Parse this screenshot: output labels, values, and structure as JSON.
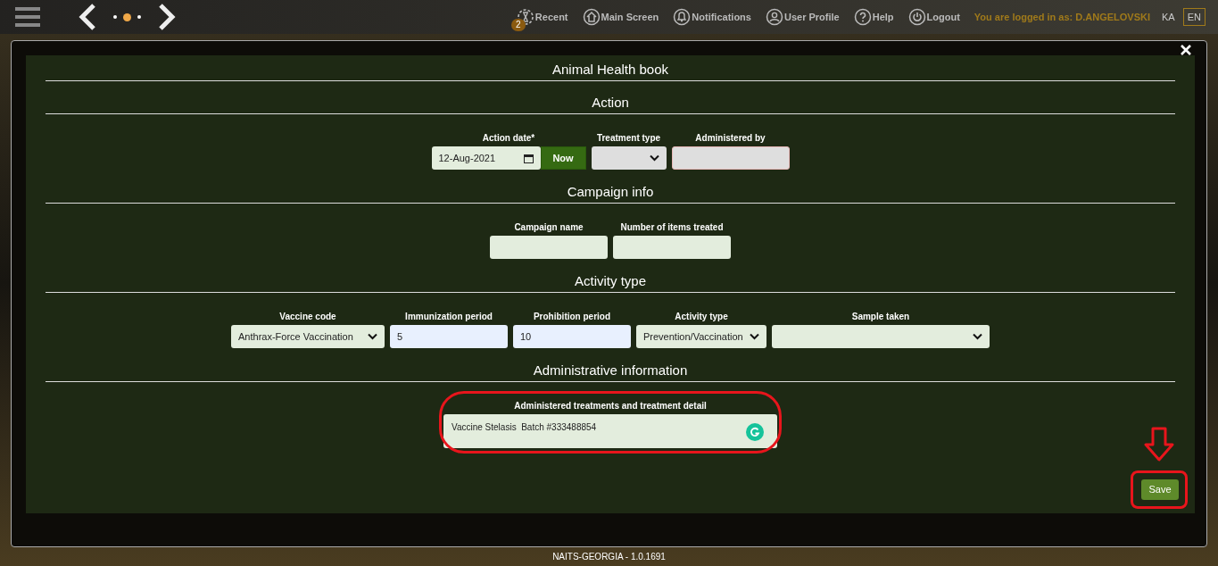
{
  "top_bar": {
    "pager": [
      {
        "selected": false
      },
      {
        "selected": true
      },
      {
        "selected": false
      }
    ],
    "nav": [
      {
        "label": "Recent",
        "badge": "2"
      },
      {
        "label": "Main Screen"
      },
      {
        "label": "Notifications"
      },
      {
        "label": "User Profile"
      },
      {
        "label": "Help"
      },
      {
        "label": "Logout"
      }
    ],
    "login_text": "You are logged in as: D.ANGELOVSKI",
    "languages": [
      {
        "label": "KA",
        "selected": false
      },
      {
        "label": "EN",
        "selected": true
      }
    ]
  },
  "modal": {
    "title": "Animal Health book",
    "sections": [
      {
        "heading": "Action",
        "fields": [
          {
            "label": "Action date*",
            "kind": "date",
            "value": "12-Aug-2021",
            "button": "Now"
          },
          {
            "label": "Treatment type",
            "kind": "select",
            "disabled": true
          },
          {
            "label": "Administered by",
            "kind": "text",
            "disabled": true
          }
        ]
      },
      {
        "heading": "Campaign info",
        "fields": [
          {
            "label": "Campaign name",
            "kind": "text",
            "disabled": false
          },
          {
            "label": "Number of items treated",
            "kind": "text",
            "disabled": false
          }
        ]
      },
      {
        "heading": "Activity type",
        "fields": [
          {
            "label": "Vaccine code",
            "kind": "select",
            "value": "Anthrax-Force Vaccination",
            "disabled": false
          },
          {
            "label": "Immunization period",
            "kind": "text",
            "value": "5",
            "disabled": false,
            "autofilled": true
          },
          {
            "label": "Prohibition period",
            "kind": "text",
            "value": "10",
            "disabled": false,
            "autofilled": true
          },
          {
            "label": "Activity type",
            "kind": "select",
            "value": "Prevention/Vaccination",
            "disabled": false
          },
          {
            "label": "Sample taken",
            "kind": "select",
            "disabled": false
          }
        ]
      },
      {
        "heading": "Administrative information",
        "fields": [
          {
            "label": "Administered treatments and treatment detail",
            "kind": "textarea",
            "value": "Vaccine Stelasis  Batch #333488854"
          }
        ]
      }
    ],
    "save_button": "Save"
  },
  "footer": "NAITS-GEORGIA - 1.0.1691"
}
